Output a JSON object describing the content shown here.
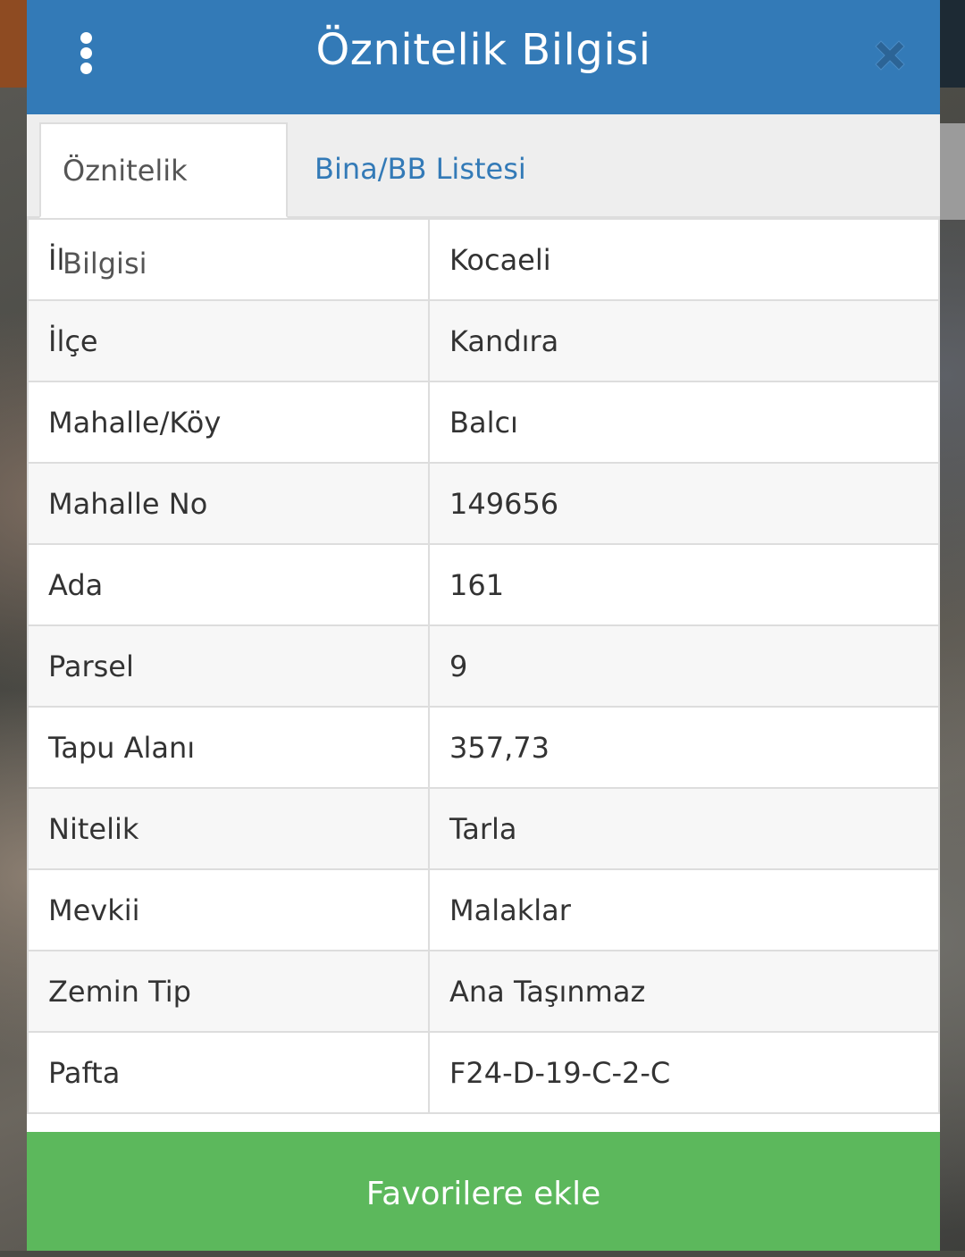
{
  "header": {
    "title": "Öznitelik Bilgisi",
    "menu_icon": "kebab-menu-icon",
    "close_icon": "close-icon",
    "close_color": "#2c6496"
  },
  "tabs": [
    {
      "label": "Öznitelik Bilgisi",
      "active": true
    },
    {
      "label": "Bina/BB Listesi",
      "active": false
    }
  ],
  "attributes": [
    {
      "key": "İl",
      "value": "Kocaeli"
    },
    {
      "key": "İlçe",
      "value": "Kandıra"
    },
    {
      "key": "Mahalle/Köy",
      "value": "Balcı"
    },
    {
      "key": "Mahalle No",
      "value": "149656"
    },
    {
      "key": "Ada",
      "value": "161"
    },
    {
      "key": "Parsel",
      "value": "9"
    },
    {
      "key": "Tapu Alanı",
      "value": "357,73"
    },
    {
      "key": "Nitelik",
      "value": "Tarla"
    },
    {
      "key": "Mevkii",
      "value": "Malaklar"
    },
    {
      "key": "Zemin Tip",
      "value": "Ana Taşınmaz"
    },
    {
      "key": "Pafta",
      "value": "F24-D-19-C-2-C"
    }
  ],
  "footer": {
    "favorite_label": "Favorilere ekle"
  },
  "colors": {
    "header_bg": "#337ab7",
    "tab_link": "#337ab7",
    "button_bg": "#5cb85c"
  }
}
